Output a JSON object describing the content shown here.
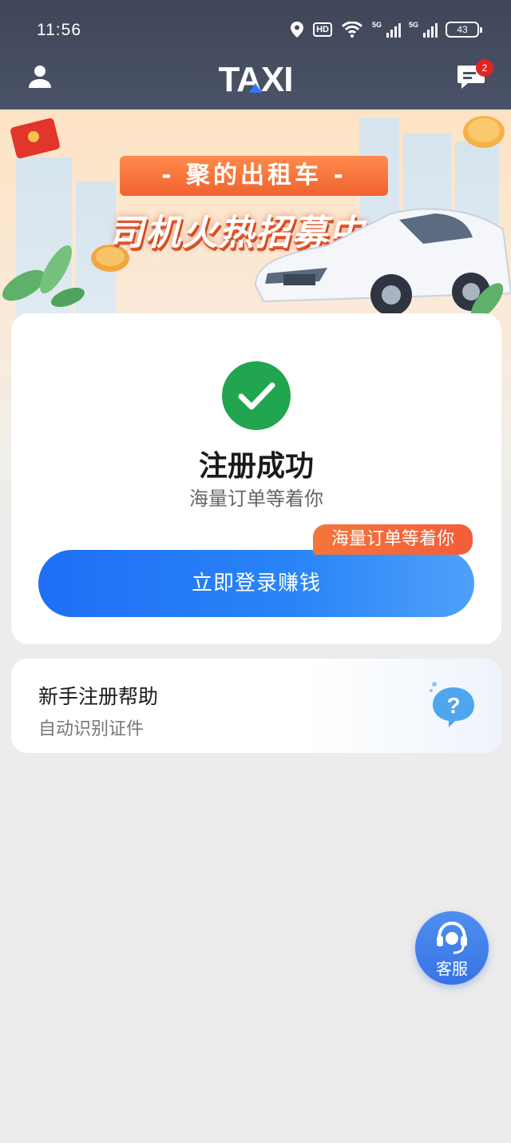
{
  "status_bar": {
    "time": "11:56",
    "hd_label": "HD",
    "signal_1": "5G",
    "signal_2": "5G",
    "battery": "43"
  },
  "header": {
    "logo_text": "TAXI",
    "message_badge": "2"
  },
  "banner": {
    "ribbon": "- 聚的出租车 -",
    "slogan": "司机火热招募中"
  },
  "success_card": {
    "title": "注册成功",
    "subtitle": "海量订单等着你",
    "tag": "海量订单等着你",
    "login_button": "立即登录赚钱"
  },
  "help_card": {
    "title": "新手注册帮助",
    "subtitle": "自动识别证件"
  },
  "customer_service": {
    "label": "客服"
  },
  "colors": {
    "header_bg": "#434a5e",
    "success_green": "#21a64f",
    "primary_blue": "#1f6ef5",
    "tag_orange": "#f4763b",
    "badge_red": "#e02424"
  }
}
